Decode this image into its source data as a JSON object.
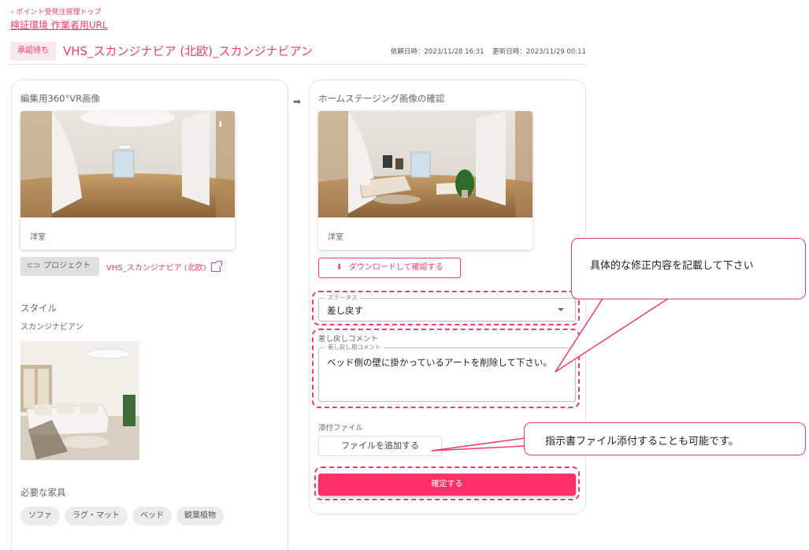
{
  "breadcrumb": {
    "back_label": "‹ ポイント受発注管理トップ"
  },
  "env_link": "検証環境 作業者用URL",
  "header": {
    "status_badge": "承認待ち",
    "title": "VHS_スカンジナビア (北欧)_スカンジナビアン",
    "requested_at": "依頼日時：2023/11/28 16:31",
    "updated_at": "更新日時：2023/11/29 00:11"
  },
  "left": {
    "vr_label": "編集用360°VR画像",
    "vr_caption": "洋室",
    "project_chip": "プロジェクト",
    "project_link": "VHS_スカンジナビア (北欧)",
    "style_label": "スタイル",
    "style_value": "スカンジナビアン",
    "furniture_label": "必要な家具",
    "furniture": [
      "ソファ",
      "ラグ・マット",
      "ベッド",
      "観葉植物"
    ]
  },
  "right": {
    "staging_label": "ホームステージング画像の確認",
    "staging_caption": "洋室",
    "download_button": "ダウンロードして確認する",
    "status_legend": "ステータス",
    "status_value": "差し戻す",
    "comment_heading": "差し戻しコメント",
    "comment_legend": "差し戻し用コメント",
    "comment_value": "ベッド側の壁に掛かっているアートを削除して下さい。",
    "attach_label": "添付ファイル",
    "attach_button": "ファイルを追加する",
    "confirm_button": "確定する"
  },
  "callouts": {
    "comment_note": "具体的な修正内容を記載して下さい",
    "attach_note": "指示書ファイル添付することも可能です。"
  },
  "icons": {
    "arrow": "arrow-right-icon",
    "link": "link-icon",
    "download": "download-icon",
    "external": "external-link-icon",
    "caret": "caret-down-icon"
  },
  "colors": {
    "accent": "#e83e6b",
    "confirm": "#ff2f68",
    "badge_bg": "#fde8ee"
  }
}
